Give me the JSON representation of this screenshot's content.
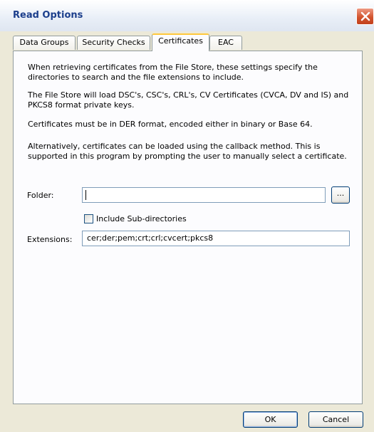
{
  "window": {
    "title": "Read Options",
    "close_icon": "close-icon"
  },
  "tabs": [
    {
      "label": "Data Groups",
      "active": false
    },
    {
      "label": "Security Checks",
      "active": false
    },
    {
      "label": "Certificates",
      "active": true
    },
    {
      "label": "EAC",
      "active": false
    }
  ],
  "certificates": {
    "paragraphs": [
      "When retrieving certificates from the File Store, these settings specify the directories to search and the file extensions to include.",
      "The File Store will load DSC's, CSC's, CRL's, CV Certificates (CVCA, DV and IS) and PKCS8 format private keys.",
      "Certificates must be in DER format, encoded either in binary or Base 64.",
      "Alternatively, certificates can be loaded using the callback method. This is supported in this program by prompting the user to manually select a certificate."
    ],
    "folder_label": "Folder:",
    "folder_value": "",
    "browse_label": "...",
    "include_subdirs_label": "Include Sub-directories",
    "include_subdirs_checked": false,
    "extensions_label": "Extensions:",
    "extensions_value": "cer;der;pem;crt;crl;cvcert;pkcs8"
  },
  "buttons": {
    "ok_label": "OK",
    "cancel_label": "Cancel"
  },
  "colors": {
    "title_text": "#1c3f8c",
    "close_button": "#d2542e",
    "window_bg": "#ece9d8",
    "active_tab_highlight": "#ffc83c"
  }
}
